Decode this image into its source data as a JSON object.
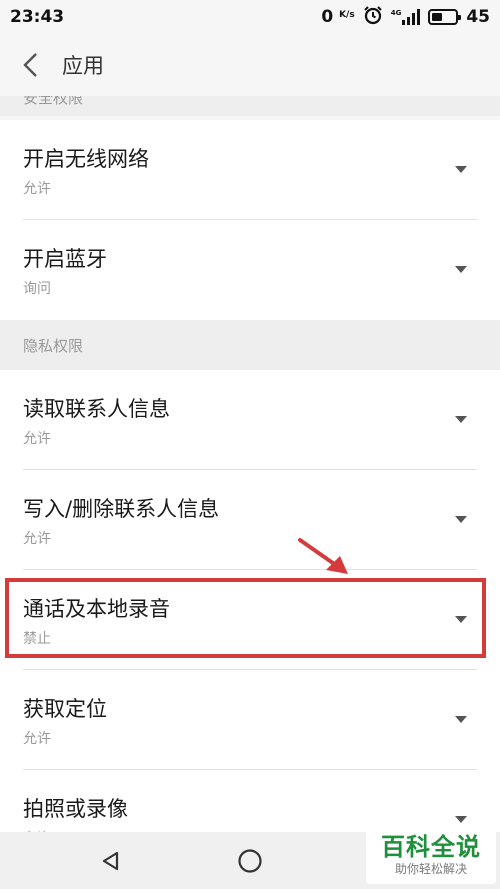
{
  "status_bar": {
    "time": "23:43",
    "speed_value": "0",
    "speed_unit": "K/s",
    "network_label": "4G",
    "battery_level": "45"
  },
  "header": {
    "title": "应用"
  },
  "sections": {
    "security_partial": {
      "label": "安全权限"
    },
    "privacy": {
      "label": "隐私权限"
    }
  },
  "permissions": [
    {
      "title": "开启无线网络",
      "value": "允许"
    },
    {
      "title": "开启蓝牙",
      "value": "询问"
    },
    {
      "title": "读取联系人信息",
      "value": "允许"
    },
    {
      "title": "写入/删除联系人信息",
      "value": "允许"
    },
    {
      "title": "通话及本地录音",
      "value": "禁止"
    },
    {
      "title": "获取定位",
      "value": "允许"
    },
    {
      "title": "拍照或录像",
      "value": "允许"
    }
  ],
  "annotation": {
    "color": "#d53b3b"
  },
  "watermark": {
    "main": "百科全说",
    "sub": "助你轻松解决"
  }
}
